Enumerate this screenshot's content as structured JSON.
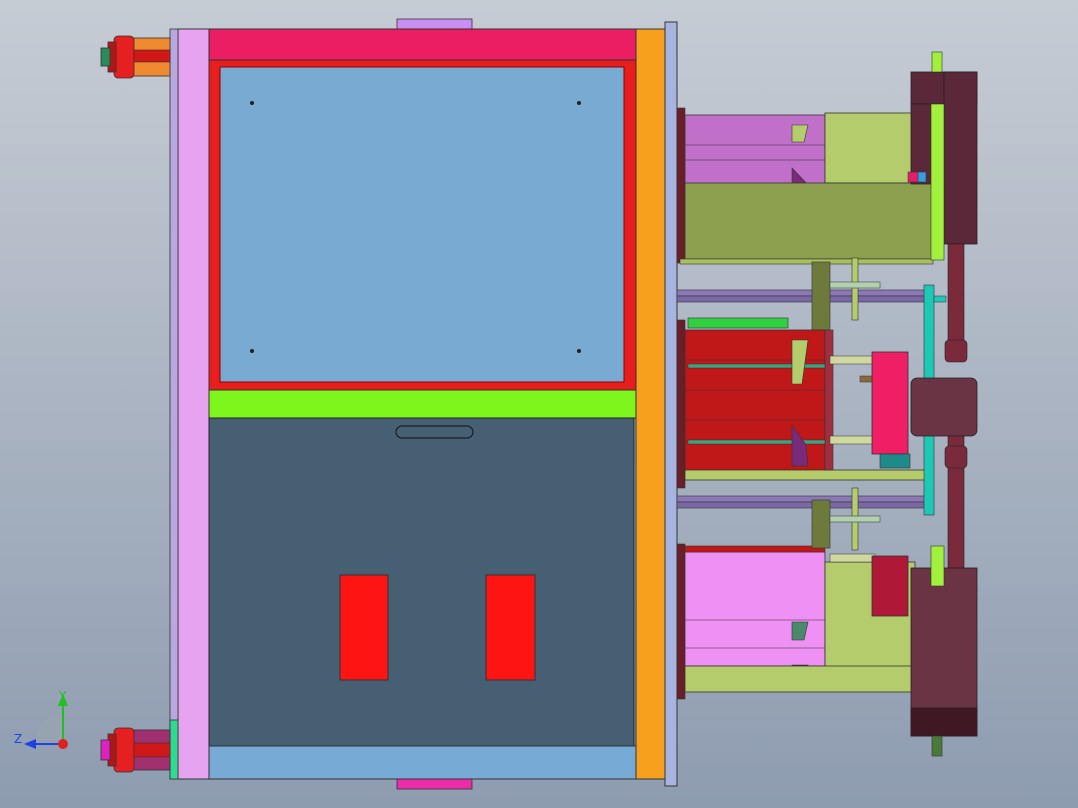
{
  "viewport": {
    "background": [
      "#c6ccd4",
      "#8e9cb0"
    ]
  },
  "triad": {
    "y_label": "Y",
    "z_label": "Z",
    "y_color": "#20c020",
    "z_color": "#2040e0",
    "x_color": "#e02020"
  },
  "colors": {
    "frame_pink": "#e6a4f0",
    "top_plate": "#ec1e63",
    "orange_plate": "#f7a01e",
    "cavity_red": "#e81e1e",
    "cavity_blue": "#78aad2",
    "green_bar": "#7ff51e",
    "dark_plate": "#465f73",
    "insert_red": "#ff1414",
    "bottom_blue": "#78aad6",
    "slider_pink": "#c070c8",
    "olive": "#b4cc6c",
    "dark_olive": "#8ca050",
    "rod_purple": "#8c78b4",
    "maroon": "#5a2838",
    "cylinder_maroon": "#6a3444",
    "teal": "#1ec8b4",
    "lime": "#a0f03c"
  }
}
